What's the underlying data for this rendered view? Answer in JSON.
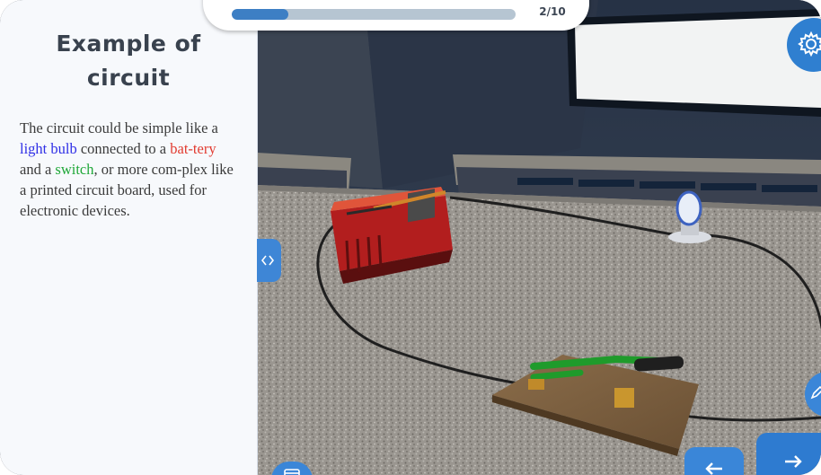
{
  "lesson": {
    "title": "Example of circuit",
    "body": {
      "p1": "The circuit could be simple like a ",
      "light_bulb": "light bulb",
      "p2": " connected to a ",
      "battery": "bat-tery",
      "p3": " and a ",
      "switch": "switch",
      "p4": ", or more com-plex like a printed circuit board, used for electronic devices."
    }
  },
  "progress": {
    "current": 2,
    "total": 10,
    "label": "2/10",
    "fraction": 0.2
  },
  "controls": {
    "settings_icon": "gear-icon",
    "collapse_icon": "code-brackets-icon",
    "edit_icon": "pencil-icon",
    "prev_icon": "arrow-left-icon",
    "next_icon": "arrow-right-icon",
    "bottom_icon": "window-icon"
  },
  "scene": {
    "objects": [
      "battery",
      "light-bulb",
      "switch",
      "wire"
    ]
  },
  "colors": {
    "accent": "#2f7fd0",
    "highlight_blue": "#2f2fe6",
    "highlight_red": "#e23a2f",
    "highlight_green": "#21a83a"
  }
}
